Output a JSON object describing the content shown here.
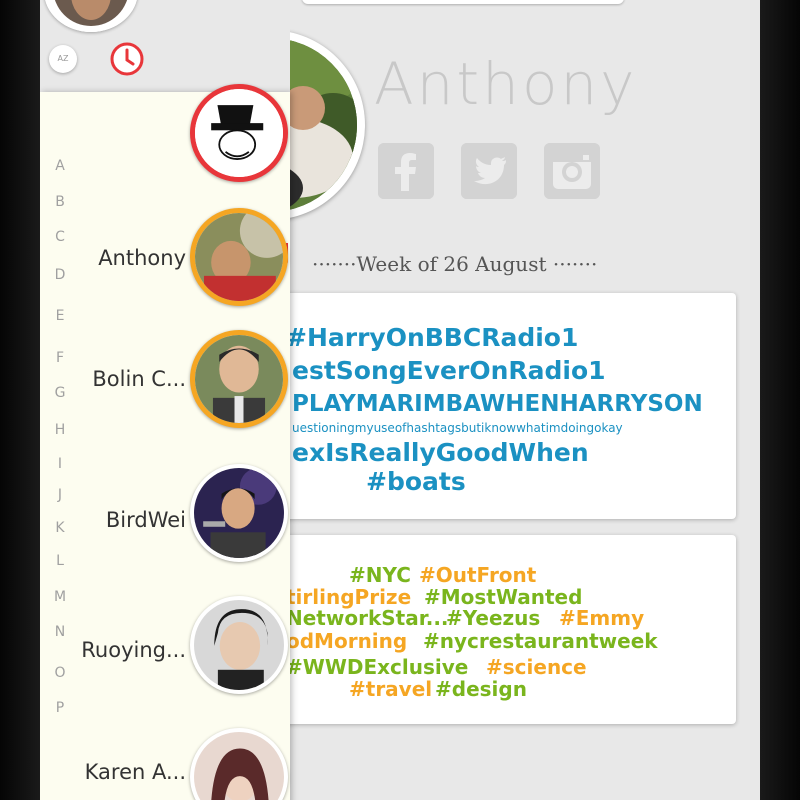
{
  "profile": {
    "name": "Anthony",
    "week_label": "·······Week of 26 August ·······"
  },
  "social_icons": [
    "facebook-icon",
    "twitter-icon",
    "instagram-icon"
  ],
  "sidebar": {
    "sort_az_label": "AZ",
    "index_letters": [
      "A",
      "B",
      "C",
      "D",
      "E",
      "F",
      "G",
      "H",
      "I",
      "J",
      "K",
      "L",
      "M",
      "N",
      "O",
      "P"
    ],
    "contacts": [
      {
        "name": "Anthony",
        "ring": true
      },
      {
        "name": "Bolin C...",
        "ring": true
      },
      {
        "name": "BirdWei",
        "ring": false
      },
      {
        "name": "Ruoying...",
        "ring": false
      },
      {
        "name": "Karen A...",
        "ring": false
      }
    ],
    "top_contact_badge": "p"
  },
  "cards": {
    "trending_music": [
      "#HarryOnBBCRadio1",
      "estSongEverOnRadio1",
      "PLAYMARIMBAWHENHARRYSON",
      "uestioningmyuseofhashtagsbutiknowwhatimdoingokay",
      "exIsReallyGoodWhen",
      "#boats"
    ],
    "trending_general": [
      "#NYC",
      "#OutFront",
      "tirlingPrize",
      "#MostWanted",
      "NetworkStar...",
      "#Yeezus",
      "#Emmy",
      "odMorning",
      "#nycrestaurantweek",
      "#WWDExclusive",
      "#science",
      "#travel",
      "#design"
    ]
  },
  "colors": {
    "tag_blue": "#1b91c2",
    "tag_green": "#7ab51d",
    "tag_orange": "#f5a623",
    "ring_orange": "#f5a623",
    "badge_red": "#e8363a"
  }
}
